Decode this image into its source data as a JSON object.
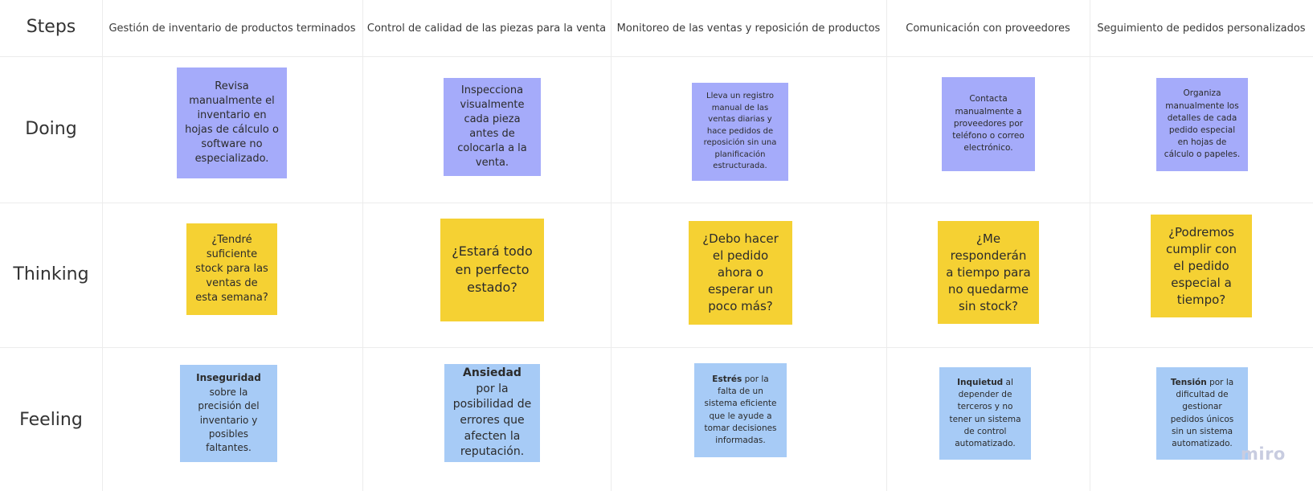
{
  "rows": {
    "steps": "Steps",
    "doing": "Doing",
    "thinking": "Thinking",
    "feeling": "Feeling"
  },
  "columns": [
    "Gestión de inventario de productos terminados",
    "Control de calidad de las piezas para la venta",
    "Monitoreo de las ventas y reposición de productos",
    "Comunicación con proveedores",
    "Seguimiento de pedidos personalizados"
  ],
  "doing": [
    "Revisa manualmente el inventario en hojas de cálculo o software no especializado.",
    "Inspecciona visualmente cada pieza antes de colocarla a la venta.",
    "Lleva un registro manual de las ventas diarias y hace pedidos de reposición sin una planificación estructurada.",
    "Contacta manualmente a proveedores por teléfono o correo electrónico.",
    "Organiza manualmente los detalles de cada pedido especial en hojas de cálculo o papeles."
  ],
  "thinking": [
    "¿Tendré suficiente stock para las ventas de esta semana?",
    "¿Estará todo en perfecto estado?",
    "¿Debo hacer el pedido ahora o esperar un poco más?",
    "¿Me responderán a tiempo para no quedarme sin stock?",
    "¿Podremos cumplir con el pedido especial a tiempo?"
  ],
  "feeling": [
    {
      "bold": "Inseguridad",
      "rest": " sobre la precisión del inventario y posibles faltantes."
    },
    {
      "bold": "Ansiedad",
      "rest": " por la posibilidad de errores que afecten la reputación."
    },
    {
      "bold": "Estrés",
      "rest": " por la falta de un sistema eficiente que le ayude a tomar decisiones informadas."
    },
    {
      "bold": "Inquietud",
      "rest": " al depender de terceros y no tener un sistema de control automatizado."
    },
    {
      "bold": "Tensión",
      "rest": " por la dificultad de gestionar pedidos únicos sin un sistema automatizado."
    }
  ],
  "logo": "miro",
  "colors": {
    "doing_note": "#a5abfa",
    "thinking_note": "#f5d133",
    "feeling_note": "#a7cbf6",
    "grid_line": "#ececec"
  }
}
